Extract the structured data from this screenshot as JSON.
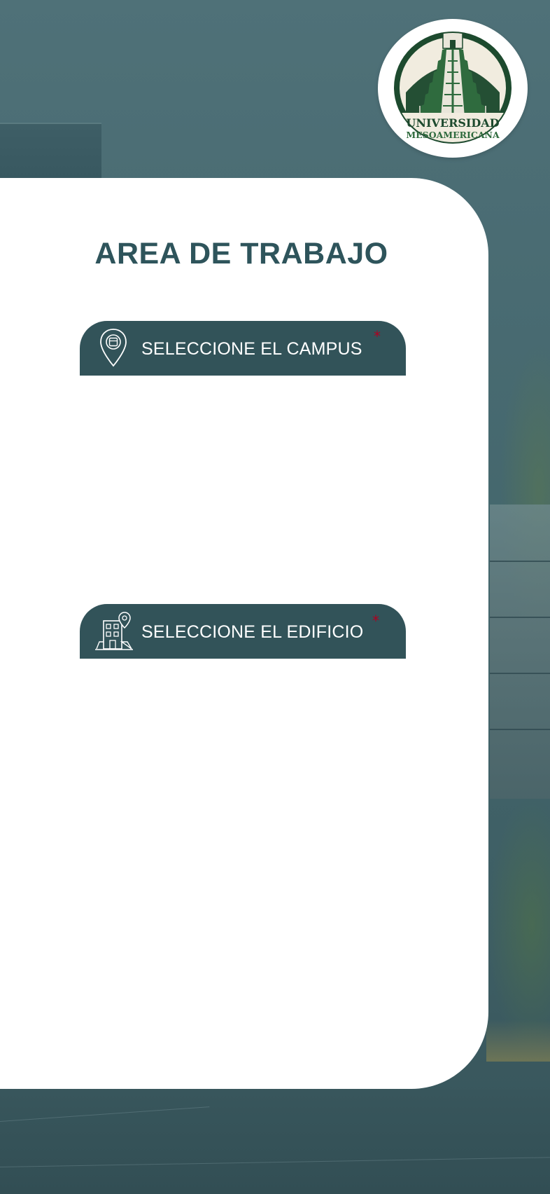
{
  "logo": {
    "line1": "UNIVERSIDAD",
    "line2": "MESOAMERICANA",
    "colors": {
      "green_dark": "#1d4a2e",
      "green_light": "#2f6b3e",
      "cream": "#f1ecdf"
    }
  },
  "card": {
    "title": "AREA DE TRABAJO"
  },
  "campus_selector": {
    "label": "SELECCIONE EL CAMPUS",
    "required_mark": "*",
    "icon": "location-pin-icon"
  },
  "building_selector": {
    "label": "SELECCIONE EL EDIFICIO",
    "required_mark": "*",
    "icon": "building-location-icon"
  },
  "colors": {
    "primary": "#325359",
    "title": "#2e545b",
    "required": "#b00020",
    "background_overlay": "#46686e"
  }
}
